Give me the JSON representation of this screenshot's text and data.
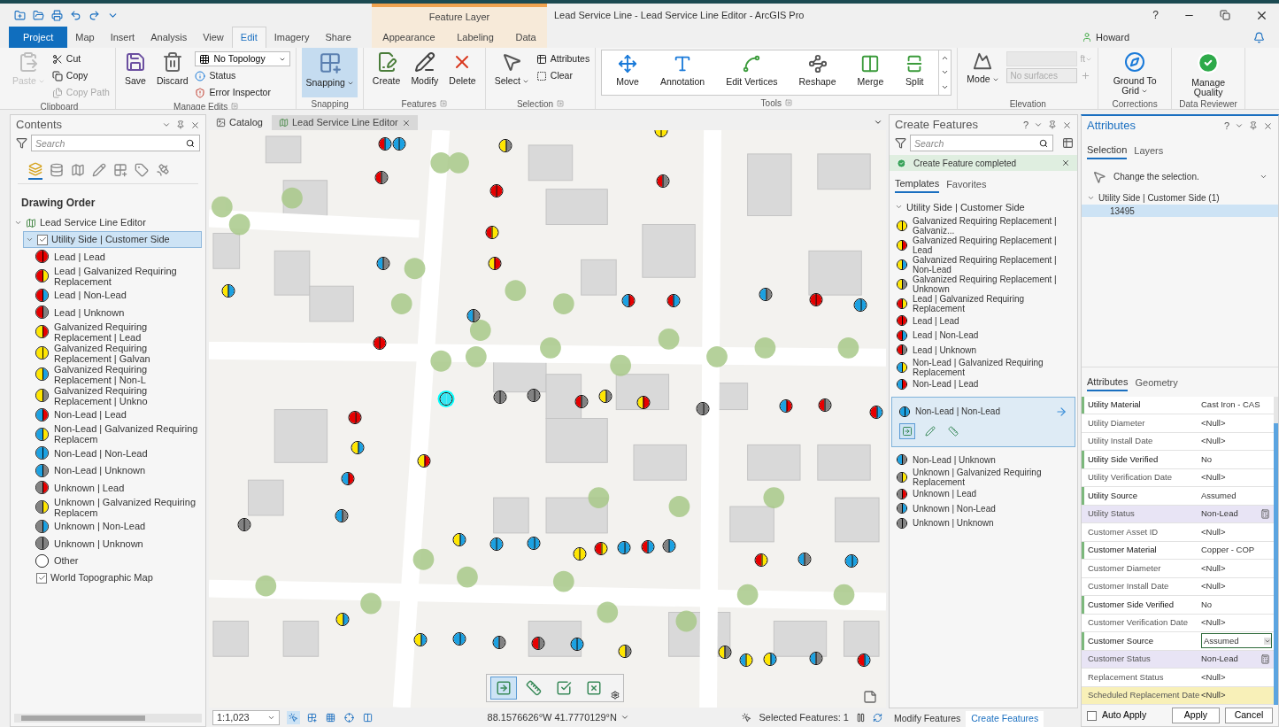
{
  "window": {
    "title": "Lead Service Line - Lead Service Line Editor - ArcGIS Pro",
    "context_group": "Feature Layer",
    "help": "?",
    "user": "Howard"
  },
  "tabs": [
    {
      "label": "Project",
      "kind": "backstage",
      "selected": false
    },
    {
      "label": "Map",
      "kind": "core",
      "selected": false
    },
    {
      "label": "Insert",
      "kind": "core",
      "selected": false
    },
    {
      "label": "Analysis",
      "kind": "core",
      "selected": false
    },
    {
      "label": "View",
      "kind": "core",
      "selected": false
    },
    {
      "label": "Edit",
      "kind": "core",
      "selected": true
    },
    {
      "label": "Imagery",
      "kind": "core",
      "selected": false
    },
    {
      "label": "Share",
      "kind": "core",
      "selected": false
    },
    {
      "label": "Appearance",
      "kind": "contextual",
      "selected": false
    },
    {
      "label": "Labeling",
      "kind": "contextual",
      "selected": false
    },
    {
      "label": "Data",
      "kind": "contextual",
      "selected": false
    }
  ],
  "ribbon": [
    {
      "title": "Clipboard",
      "launcher": false,
      "items": [
        {
          "kind": "large",
          "label": "Paste",
          "disabled": true,
          "dropdown": true,
          "selected": false
        },
        {
          "kind": "stack",
          "children": [
            {
              "kind": "small",
              "label": "Cut",
              "disabled": false
            },
            {
              "kind": "small",
              "label": "Copy",
              "disabled": false
            },
            {
              "kind": "small",
              "label": "Copy Path",
              "disabled": true
            }
          ]
        }
      ]
    },
    {
      "title": "Manage Edits",
      "launcher": true,
      "items": [
        {
          "kind": "large",
          "label": "Save",
          "disabled": false,
          "dropdown": false,
          "selected": false
        },
        {
          "kind": "large",
          "label": "Discard",
          "disabled": false,
          "dropdown": false,
          "selected": false
        },
        {
          "kind": "stack",
          "children": [
            {
              "kind": "combo",
              "label": "No Topology",
              "disabled": false
            },
            {
              "kind": "small",
              "label": "Status",
              "disabled": false
            },
            {
              "kind": "small",
              "label": "Error Inspector",
              "disabled": false
            }
          ]
        }
      ]
    },
    {
      "title": "Snapping",
      "launcher": false,
      "items": [
        {
          "kind": "large",
          "label": "Snapping",
          "disabled": false,
          "dropdown": true,
          "selected": true
        }
      ]
    },
    {
      "title": "Features",
      "launcher": true,
      "items": [
        {
          "kind": "large",
          "label": "Create",
          "disabled": false,
          "dropdown": false,
          "selected": false
        },
        {
          "kind": "large",
          "label": "Modify",
          "disabled": false,
          "dropdown": false,
          "selected": false
        },
        {
          "kind": "large",
          "label": "Delete",
          "disabled": false,
          "dropdown": false,
          "selected": false
        }
      ]
    },
    {
      "title": "Selection",
      "launcher": true,
      "items": [
        {
          "kind": "large",
          "label": "Select",
          "disabled": false,
          "dropdown": true,
          "selected": false
        },
        {
          "kind": "stack",
          "children": [
            {
              "kind": "small",
              "label": "Attributes",
              "disabled": false
            },
            {
              "kind": "small",
              "label": "Clear",
              "disabled": false
            }
          ]
        }
      ]
    },
    {
      "title": "Tools",
      "launcher": true,
      "items": [
        {
          "kind": "gallery",
          "children": [
            {
              "label": "Move"
            },
            {
              "label": "Annotation"
            },
            {
              "label": "Edit Vertices"
            },
            {
              "label": "Reshape"
            },
            {
              "label": "Merge"
            },
            {
              "label": "Split"
            }
          ]
        }
      ]
    },
    {
      "title": "Elevation",
      "launcher": false,
      "items": [
        {
          "kind": "large",
          "label": "Mode",
          "disabled": false,
          "dropdown": true,
          "selected": false
        },
        {
          "kind": "stack",
          "children": [
            {
              "kind": "unitcombo",
              "label": "ft",
              "disabled": true
            },
            {
              "kind": "surface",
              "label": "No surfaces",
              "disabled": true
            }
          ]
        }
      ]
    },
    {
      "title": "Corrections",
      "launcher": false,
      "items": [
        {
          "kind": "large",
          "label": "Ground To Grid",
          "disabled": false,
          "dropdown": true,
          "selected": false
        }
      ]
    },
    {
      "title": "Data Reviewer",
      "launcher": false,
      "items": [
        {
          "kind": "large",
          "label": "Manage Quality",
          "disabled": false,
          "dropdown": false,
          "selected": false
        }
      ]
    }
  ],
  "contents": {
    "title": "Contents",
    "search": {
      "placeholder": "Search"
    },
    "views": [
      {
        "selected": true
      },
      {
        "selected": false
      },
      {
        "selected": false
      },
      {
        "selected": false
      },
      {
        "selected": false
      },
      {
        "selected": false
      },
      {
        "selected": false
      }
    ],
    "heading": "Drawing Order",
    "tree": [
      {
        "label": "Lead Service Line Editor",
        "expanded": true,
        "children": [
          {
            "label": "Utility Side | Customer Side",
            "checked": true,
            "selected": true,
            "expanded": true,
            "legend": [
              {
                "label": "Lead | Lead",
                "kind": "lead-lead"
              },
              {
                "label": "Lead | Galvanized Requiring Replacement",
                "kind": "lead-galv"
              },
              {
                "label": "Lead | Non-Lead",
                "kind": "lead-nonlead"
              },
              {
                "label": "Lead | Unknown",
                "kind": "lead-unknown"
              },
              {
                "label": "Galvanized Requiring Replacement | Lead",
                "kind": "galv-lead"
              },
              {
                "label": "Galvanized Requiring Replacement | Galvan",
                "kind": "galv-galv"
              },
              {
                "label": "Galvanized Requiring Replacement | Non-L",
                "kind": "galv-nonlead"
              },
              {
                "label": "Galvanized Requiring Replacement | Unkno",
                "kind": "galv-unknown"
              },
              {
                "label": "Non-Lead | Lead",
                "kind": "nonlead-lead"
              },
              {
                "label": "Non-Lead | Galvanized Requiring Replacem",
                "kind": "nonlead-galv"
              },
              {
                "label": "Non-Lead | Non-Lead",
                "kind": "nonlead-nonlead"
              },
              {
                "label": "Non-Lead | Unknown",
                "kind": "nonlead-unknown"
              },
              {
                "label": "Unknown | Lead",
                "kind": "unknown-lead"
              },
              {
                "label": "Unknown | Galvanized Requiring Replacem",
                "kind": "unknown-galv"
              },
              {
                "label": "Unknown | Non-Lead",
                "kind": "unknown-nonlead"
              },
              {
                "label": "Unknown | Unknown",
                "kind": "unknown-unknown"
              },
              {
                "label": "Other",
                "kind": "other"
              }
            ]
          },
          {
            "label": "World Topographic Map",
            "checked": true,
            "selected": false
          }
        ]
      }
    ]
  },
  "map_view": {
    "tabs": [
      {
        "label": "Catalog",
        "kind": "catalog",
        "selected": false
      },
      {
        "label": "Lead Service Line Editor",
        "kind": "map",
        "selected": true
      }
    ],
    "markers": [
      {
        "kind": "lead-nonlead",
        "selected": false
      },
      {
        "kind": "nonlead-nonlead",
        "selected": false
      },
      {
        "kind": "galv-unknown",
        "selected": false
      },
      {
        "kind": "galv-galv",
        "selected": false
      },
      {
        "kind": "lead-unknown",
        "selected": false
      },
      {
        "kind": "lead-unknown",
        "selected": false
      },
      {
        "kind": "lead-lead",
        "selected": false
      },
      {
        "kind": "lead-galv",
        "selected": false
      },
      {
        "kind": "galv-lead",
        "selected": false
      },
      {
        "kind": "nonlead-unknown",
        "selected": false
      },
      {
        "kind": "galv-nonlead",
        "selected": false
      },
      {
        "kind": "nonlead-lead",
        "selected": false
      },
      {
        "kind": "lead-nonlead",
        "selected": false
      },
      {
        "kind": "nonlead-unknown",
        "selected": false
      },
      {
        "kind": "lead-lead",
        "selected": false
      },
      {
        "kind": "nonlead-nonlead",
        "selected": false
      },
      {
        "kind": "nonlead-unknown",
        "selected": false
      },
      {
        "kind": "lead-lead",
        "selected": false
      },
      {
        "kind": "nonlead-nonlead",
        "selected": true
      },
      {
        "kind": "unknown-unknown",
        "selected": false
      },
      {
        "kind": "unknown-unknown",
        "selected": false
      },
      {
        "kind": "lead-unknown",
        "selected": false
      },
      {
        "kind": "galv-unknown",
        "selected": false
      },
      {
        "kind": "galv-lead",
        "selected": false
      },
      {
        "kind": "unknown-unknown",
        "selected": false
      },
      {
        "kind": "nonlead-lead",
        "selected": false
      },
      {
        "kind": "lead-unknown",
        "selected": false
      },
      {
        "kind": "lead-nonlead",
        "selected": false
      },
      {
        "kind": "lead-lead",
        "selected": false
      },
      {
        "kind": "galv-nonlead",
        "selected": false
      },
      {
        "kind": "galv-lead",
        "selected": false
      },
      {
        "kind": "nonlead-lead",
        "selected": false
      },
      {
        "kind": "nonlead-unknown",
        "selected": false
      },
      {
        "kind": "unknown-unknown",
        "selected": false
      },
      {
        "kind": "galv-nonlead",
        "selected": false
      },
      {
        "kind": "nonlead-nonlead",
        "selected": false
      },
      {
        "kind": "nonlead-nonlead",
        "selected": false
      },
      {
        "kind": "galv-galv",
        "selected": false
      },
      {
        "kind": "lead-galv",
        "selected": false
      },
      {
        "kind": "nonlead-nonlead",
        "selected": false
      },
      {
        "kind": "lead-nonlead",
        "selected": false
      },
      {
        "kind": "unknown-nonlead",
        "selected": false
      },
      {
        "kind": "lead-galv",
        "selected": false
      },
      {
        "kind": "nonlead-unknown",
        "selected": false
      },
      {
        "kind": "nonlead-nonlead",
        "selected": false
      },
      {
        "kind": "galv-nonlead",
        "selected": false
      },
      {
        "kind": "galv-nonlead",
        "selected": false
      },
      {
        "kind": "nonlead-nonlead",
        "selected": false
      },
      {
        "kind": "nonlead-unknown",
        "selected": false
      },
      {
        "kind": "lead-unknown",
        "selected": false
      },
      {
        "kind": "nonlead-nonlead",
        "selected": false
      },
      {
        "kind": "galv-unknown",
        "selected": false
      },
      {
        "kind": "galv-unknown",
        "selected": false
      },
      {
        "kind": "nonlead-galv",
        "selected": false
      },
      {
        "kind": "galv-nonlead",
        "selected": false
      },
      {
        "kind": "nonlead-unknown",
        "selected": false
      },
      {
        "kind": "lead-nonlead",
        "selected": false
      }
    ],
    "floating_tools": [
      {
        "selected": true
      },
      {
        "selected": false
      },
      {
        "selected": false
      },
      {
        "selected": false
      }
    ],
    "status": {
      "scale": "1:1,023",
      "nav_tools": [
        {
          "selected": true
        },
        {
          "selected": false
        },
        {
          "selected": false
        },
        {
          "selected": false
        },
        {
          "selected": false
        }
      ],
      "coordinates": "88.1576626°W 41.7770129°N",
      "selected_features": "Selected Features: 1"
    }
  },
  "create_features": {
    "title": "Create Features",
    "help": "?",
    "search": {
      "placeholder": "Search"
    },
    "notice": "Create Feature completed",
    "tabs": [
      {
        "label": "Templates",
        "selected": true
      },
      {
        "label": "Favorites",
        "selected": false
      }
    ],
    "group": {
      "label": "Utility Side | Customer Side",
      "expanded": true
    },
    "templates": [
      {
        "label": "Galvanized Requiring Replacement | Galvaniz...",
        "kind": "galv-galv",
        "selected": false
      },
      {
        "label": "Galvanized Requiring Replacement | Lead",
        "kind": "galv-lead",
        "selected": false
      },
      {
        "label": "Galvanized Requiring Replacement | Non-Lead",
        "kind": "galv-nonlead",
        "selected": false
      },
      {
        "label": "Galvanized Requiring Replacement | Unknown",
        "kind": "galv-unknown",
        "selected": false
      },
      {
        "label": "Lead | Galvanized Requiring Replacement",
        "kind": "lead-galv",
        "selected": false
      },
      {
        "label": "Lead | Lead",
        "kind": "lead-lead",
        "selected": false
      },
      {
        "label": "Lead | Non-Lead",
        "kind": "lead-nonlead",
        "selected": false
      },
      {
        "label": "Lead | Unknown",
        "kind": "lead-unknown",
        "selected": false
      },
      {
        "label": "Non-Lead | Galvanized Requiring Replacement",
        "kind": "nonlead-galv",
        "selected": false
      },
      {
        "label": "Non-Lead | Lead",
        "kind": "nonlead-lead",
        "selected": false
      },
      {
        "label": "Non-Lead | Non-Lead",
        "kind": "nonlead-nonlead",
        "selected": true,
        "tools": [
          {
            "selected": true
          },
          {
            "selected": false
          },
          {
            "selected": false
          }
        ]
      },
      {
        "label": "Non-Lead | Unknown",
        "kind": "nonlead-unknown",
        "selected": false
      },
      {
        "label": "Unknown | Galvanized Requiring Replacement",
        "kind": "unknown-galv",
        "selected": false
      },
      {
        "label": "Unknown | Lead",
        "kind": "unknown-lead",
        "selected": false
      },
      {
        "label": "Unknown | Non-Lead",
        "kind": "unknown-nonlead",
        "selected": false
      },
      {
        "label": "Unknown | Unknown",
        "kind": "unknown-unknown",
        "selected": false
      }
    ],
    "bottom_tabs": [
      {
        "label": "Modify Features",
        "selected": false
      },
      {
        "label": "Create Features",
        "selected": true
      }
    ]
  },
  "attributes": {
    "title": "Attributes",
    "help": "?",
    "tabs": [
      {
        "label": "Selection",
        "selected": true
      },
      {
        "label": "Layers",
        "selected": false
      }
    ],
    "selection_hint": "Change the selection.",
    "selection_tree": {
      "label": "Utility Side | Customer Side (1)",
      "expanded": true,
      "children": [
        {
          "label": "13495",
          "selected": true
        }
      ]
    },
    "detail_tabs": [
      {
        "label": "Attributes",
        "selected": true
      },
      {
        "label": "Geometry",
        "selected": false
      }
    ],
    "rows": [
      {
        "label": "Utility Material",
        "value": "Cast Iron - CAS",
        "required": true,
        "kind": "text"
      },
      {
        "label": "Utility Diameter",
        "value": "<Null>",
        "required": false,
        "kind": "text"
      },
      {
        "label": "Utility Install Date",
        "value": "<Null>",
        "required": false,
        "kind": "text"
      },
      {
        "label": "Utility Side Verified",
        "value": "No",
        "required": true,
        "kind": "text"
      },
      {
        "label": "Utility Verification Date",
        "value": "<Null>",
        "required": false,
        "kind": "text"
      },
      {
        "label": "Utility Source",
        "value": "Assumed",
        "required": true,
        "kind": "text"
      },
      {
        "label": "Utility Status",
        "value": "Non-Lead",
        "required": false,
        "kind": "calculated"
      },
      {
        "label": "Customer Asset ID",
        "value": "<Null>",
        "required": false,
        "kind": "text"
      },
      {
        "label": "Customer Material",
        "value": "Copper - COP",
        "required": true,
        "kind": "text"
      },
      {
        "label": "Customer Diameter",
        "value": "<Null>",
        "required": false,
        "kind": "text"
      },
      {
        "label": "Customer Install Date",
        "value": "<Null>",
        "required": false,
        "kind": "text"
      },
      {
        "label": "Customer Side Verified",
        "value": "No",
        "required": true,
        "kind": "text"
      },
      {
        "label": "Customer Verification Date",
        "value": "<Null>",
        "required": false,
        "kind": "text"
      },
      {
        "label": "Customer Source",
        "value": "Assumed",
        "required": true,
        "kind": "combo"
      },
      {
        "label": "Customer Status",
        "value": "Non-Lead",
        "required": false,
        "kind": "calculated"
      },
      {
        "label": "Replacement Status",
        "value": "<Null>",
        "required": false,
        "kind": "text"
      },
      {
        "label": "Scheduled Replacement Date",
        "value": "<Null>",
        "required": false,
        "kind": "highlighted"
      }
    ],
    "auto_apply": {
      "label": "Auto Apply",
      "checked": false
    },
    "buttons": [
      "Apply",
      "Cancel"
    ]
  }
}
